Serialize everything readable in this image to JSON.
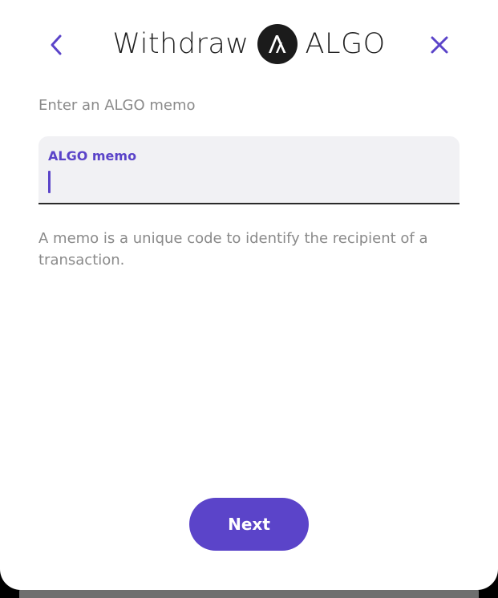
{
  "header": {
    "title_prefix": "Withdraw",
    "title_asset": "ALGO",
    "back_icon": "chevron-left-icon",
    "close_icon": "close-icon",
    "logo_icon": "algorand-logo-icon"
  },
  "form": {
    "prompt": "Enter an ALGO memo",
    "memo_label": "ALGO memo",
    "memo_value": "",
    "helper_text": "A memo is a unique code to identify the recipient of a transaction."
  },
  "footer": {
    "next_label": "Next"
  },
  "colors": {
    "accent": "#5b44c9",
    "title": "#222222",
    "muted": "#8a8a8a",
    "field_background": "#f1f1f4",
    "logo_background": "#1b1b1b"
  }
}
